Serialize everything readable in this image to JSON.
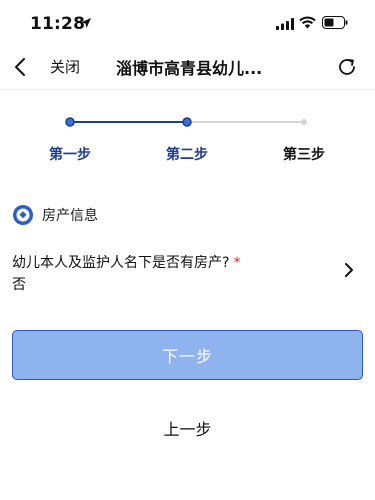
{
  "status_bar": {
    "time": "11:28",
    "icons": [
      "location-arrow-icon",
      "signal-icon",
      "wifi-icon",
      "battery-icon"
    ]
  },
  "nav": {
    "back_icon": "back-icon",
    "close_label": "关闭",
    "title": "淄博市高青县幼儿...",
    "refresh_icon": "refresh-icon"
  },
  "stepper": {
    "steps": [
      {
        "label": "第一步",
        "state": "done"
      },
      {
        "label": "第二步",
        "state": "current"
      },
      {
        "label": "第三步",
        "state": "todo"
      }
    ],
    "colors": {
      "active": "#1f3c8f",
      "inactive": "#d6d6d6"
    }
  },
  "section": {
    "icon": "house-info-icon",
    "title": "房产信息"
  },
  "question": {
    "text": "幼儿本人及监护人名下是否有房产?",
    "required_mark": "*",
    "answer": "否",
    "chevron_icon": "chevron-right-icon"
  },
  "buttons": {
    "next_label": "下一步",
    "prev_label": "上一步"
  },
  "colors": {
    "accent": "#2e5bc7",
    "button_fill": "#8fb3ee",
    "required": "#c0392b"
  }
}
